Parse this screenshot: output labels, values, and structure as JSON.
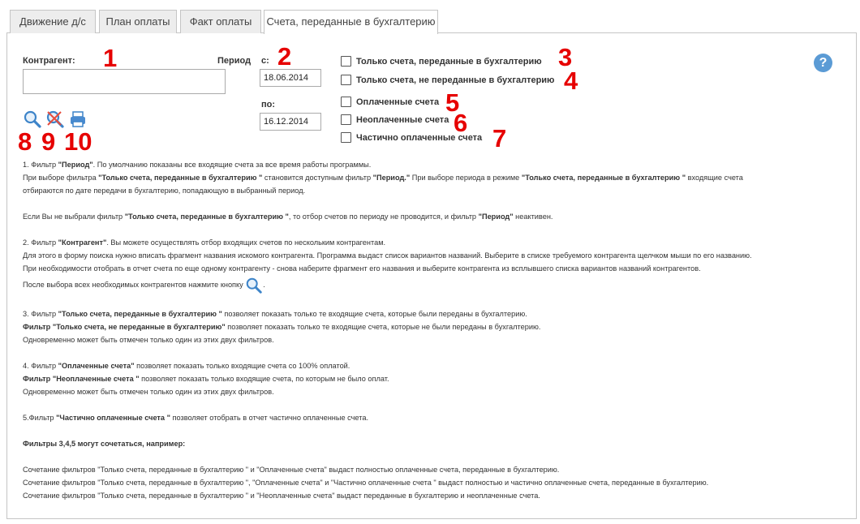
{
  "tabs": [
    {
      "label": "Движение д/с"
    },
    {
      "label": "План оплаты"
    },
    {
      "label": "Факт оплаты"
    },
    {
      "label": "Счета, переданные в бухгалтерию"
    }
  ],
  "filters": {
    "contractor_label": "Контрагент:",
    "contractor_value": "",
    "period_label": "Период",
    "from_label": "с:",
    "from_value": "18.06.2014",
    "to_label": "по:",
    "to_value": "16.12.2014"
  },
  "checkboxes": [
    {
      "label": "Только счета, переданные в бухгалтерию",
      "checked": false
    },
    {
      "label": "Только счета, не переданные в бухгалтерию",
      "checked": false
    },
    {
      "label": "Оплаченные счета",
      "checked": false
    },
    {
      "label": "Неоплаченные счета",
      "checked": false
    },
    {
      "label": "Частично оплаченные счета",
      "checked": false
    }
  ],
  "annotations": [
    "1",
    "2",
    "3",
    "4",
    "5",
    "6",
    "7",
    "8",
    "9",
    "10"
  ],
  "icons": {
    "search": "search-icon",
    "clear_filter": "clear-filter-icon",
    "print": "print-icon",
    "help": "?"
  },
  "colors": {
    "annotation": "#e60000",
    "help": "#5b9bd5",
    "icon": "#4a8bd0"
  },
  "info": {
    "p1": {
      "a": "1. Фильтр ",
      "b": "\"Период\"",
      "c": ". По умолчанию показаны все входящие счета за все время работы программы."
    },
    "p2": {
      "a": "При выборе фильтра ",
      "b": "\"Только счета, переданные в бухгалтерию \"",
      "c": " становится доступным фильтр ",
      "d": "\"Период.\"",
      "e": " При выборе периода в режиме ",
      "f": "\"Только счета, переданные в бухгалтерию \"",
      "g": " входящие счета"
    },
    "p3": "отбираются по дате передачи в бухгалтерию, попадающую в выбранный период.",
    "p4": {
      "a": "Если Вы не выбрали фильтр ",
      "b": "\"Только счета, переданные в бухгалтерию \"",
      "c": ", то отбор счетов по периоду не проводится, и фильтр ",
      "d": "\"Период\"",
      "e": " неактивен."
    },
    "p5": {
      "a": "2. Фильтр ",
      "b": "\"Контрагент\"",
      "c": ". Вы можете осуществлять отбор входящих счетов по нескольким контрагентам."
    },
    "p6": "Для этого в форму поиска нужно вписать фрагмент названия искомого контрагента. Программа выдаст список вариантов названий. Выберите в списке требуемого контрагента щелчком мыши по его названию.",
    "p7": "При необходимости отобрать в отчет счета по еще одному контрагенту - снова наберите фрагмент его названия и выберите контрагента из всплывшего списка вариантов названий контрагентов.",
    "p8": {
      "a": "После выбора всех необходимых контрагентов нажмите кнопку ",
      "b": "."
    },
    "p9": {
      "a": "3. Фильтр ",
      "b": "\"Только счета, переданные в бухгалтерию \"",
      "c": " позволяет показать только те входящие счета, которые были переданы в бухгалтерию."
    },
    "p10": {
      "a": "Фильтр ",
      "b": "\"Только счета, не переданные в бухгалтерию\"",
      "c": " позволяет показать только те входящие счета, которые не были переданы в бухгалтерию."
    },
    "p11": "Одновременно может быть отмечен только один из этих двух фильтров.",
    "p12": {
      "a": "4. Фильтр ",
      "b": "\"Оплаченные счета\"",
      "c": " позволяет показать только входящие счета со 100% оплатой."
    },
    "p13": {
      "a": "Фильтр ",
      "b": "\"Неоплаченные счета \"",
      "c": " позволяет показать только входящие счета, по которым не было оплат."
    },
    "p14": "Одновременно может быть отмечен только один из этих двух фильтров.",
    "p15": {
      "a": "5.Фильтр ",
      "b": "\"Частично оплаченные счета \"",
      "c": " позволяет отобрать в отчет частично оплаченные счета."
    },
    "p16": "Фильтры 3,4,5 могут сочетаться, например:",
    "p17": "Сочетание фильтров \"Только счета, переданные в бухгалтерию \" и \"Оплаченные счета\" выдаст полностью оплаченные счета, переданные в бухгалтерию.",
    "p18": "Сочетание фильтров \"Только счета, переданные в бухгалтерию \", \"Оплаченные счета\" и \"Частично оплаченные счета \" выдаст полностью и частично оплаченные счета, переданные в бухгалтерию.",
    "p19": "Сочетание фильтров \"Только счета, переданные в бухгалтерию \" и \"Неоплаченные счета\" выдаст переданные в бухгалтерию и неоплаченные счета."
  }
}
